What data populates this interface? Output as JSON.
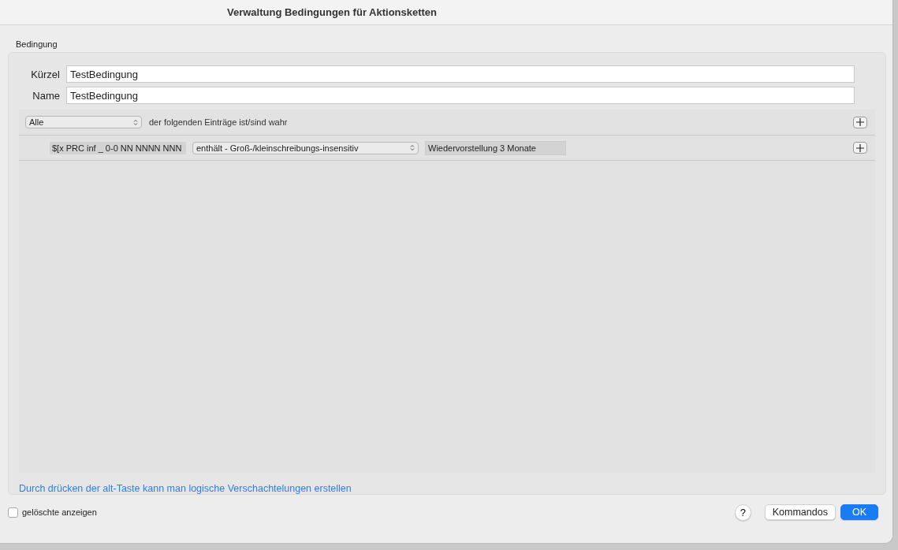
{
  "window": {
    "title": "Verwaltung Bedingungen für Aktionsketten"
  },
  "group": {
    "label": "Bedingung"
  },
  "fields": [
    {
      "label": "Kürzel",
      "value": "TestBedingung"
    },
    {
      "label": "Name",
      "value": "TestBedingung"
    }
  ],
  "rules": {
    "match": "Alle",
    "match_text": "der folgenden Einträge ist/sind wahr",
    "conditions": [
      {
        "token": "$[x PRC inf _ 0-0 NN NNNN NNN",
        "operator": "enthält - Groß-/kleinschreibungs-insensitiv",
        "value": "Wiedervorstellung 3 Monate"
      }
    ]
  },
  "hint": "Durch drücken der alt-Taste kann man logische Verschachtelungen erstellen",
  "show_deleted": {
    "label": "gelöschte anzeigen",
    "checked": false
  },
  "buttons": [
    {
      "label": "?",
      "kind": "help"
    },
    {
      "label": "Kommandos",
      "kind": "normal"
    },
    {
      "label": "OK",
      "kind": "default"
    }
  ]
}
